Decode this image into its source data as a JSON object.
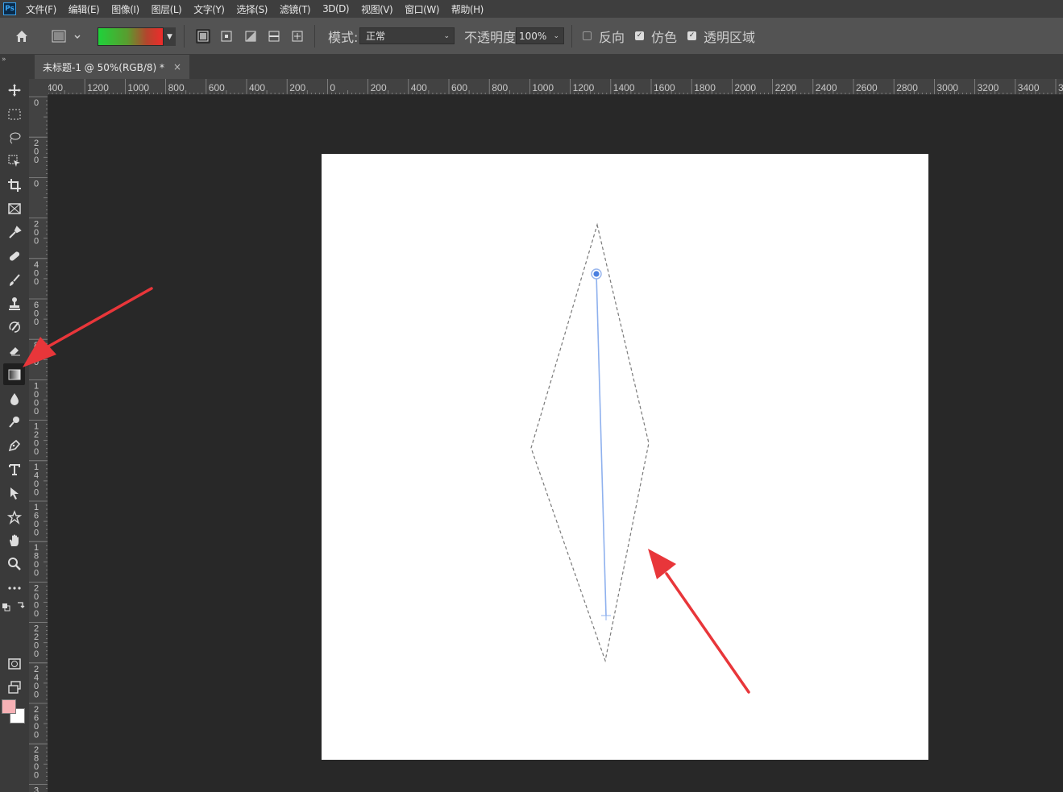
{
  "menu": {
    "app_icon_text": "Ps",
    "items": [
      "文件(F)",
      "编辑(E)",
      "图像(I)",
      "图层(L)",
      "文字(Y)",
      "选择(S)",
      "滤镜(T)",
      "3D(D)",
      "视图(V)",
      "窗口(W)",
      "帮助(H)"
    ]
  },
  "options": {
    "mode_label": "模式:",
    "mode_value": "正常",
    "opacity_label": "不透明度:",
    "opacity_value": "100%",
    "reverse_label": "反向",
    "reverse_checked": false,
    "dither_label": "仿色",
    "dither_checked": true,
    "transparency_label": "透明区域",
    "transparency_checked": true,
    "gradient_colors": [
      "#1fd23a",
      "#ee2b2b"
    ]
  },
  "tab": {
    "title": "未标题-1 @ 50%(RGB/8) *",
    "close": "×",
    "collapse": "»"
  },
  "ruler": {
    "h_labels": [
      "400",
      "1200",
      "1000",
      "800",
      "600",
      "400",
      "200",
      "0",
      "200",
      "400",
      "600",
      "800",
      "1000",
      "1200",
      "1400",
      "1600",
      "1800",
      "2000",
      "2200",
      "2400",
      "2600",
      "2800",
      "3000",
      "3200",
      "3400",
      "36"
    ],
    "v_labels": [
      "0",
      "200",
      "0",
      "200",
      "400",
      "600",
      "800",
      "1000",
      "1200",
      "1400",
      "1600",
      "1800",
      "2000",
      "2200",
      "2400",
      "2600",
      "2800",
      "3000"
    ]
  },
  "tools": [
    "move-tool",
    "marquee-tool",
    "lasso-tool",
    "object-select-tool",
    "crop-tool",
    "frame-tool",
    "eyedropper-tool",
    "healing-brush-tool",
    "brush-tool",
    "clone-stamp-tool",
    "history-brush-tool",
    "eraser-tool",
    "gradient-tool",
    "blur-tool",
    "dodge-tool",
    "pen-tool",
    "type-tool",
    "path-select-tool",
    "custom-shape-tool",
    "hand-tool",
    "zoom-tool",
    "more-tools"
  ],
  "active_tool": "gradient-tool",
  "colors": {
    "foreground": "#f7b1b5",
    "background": "#ffffff",
    "annotation_arrow": "#e8363a",
    "gradient_guide": "#4a86e8"
  }
}
